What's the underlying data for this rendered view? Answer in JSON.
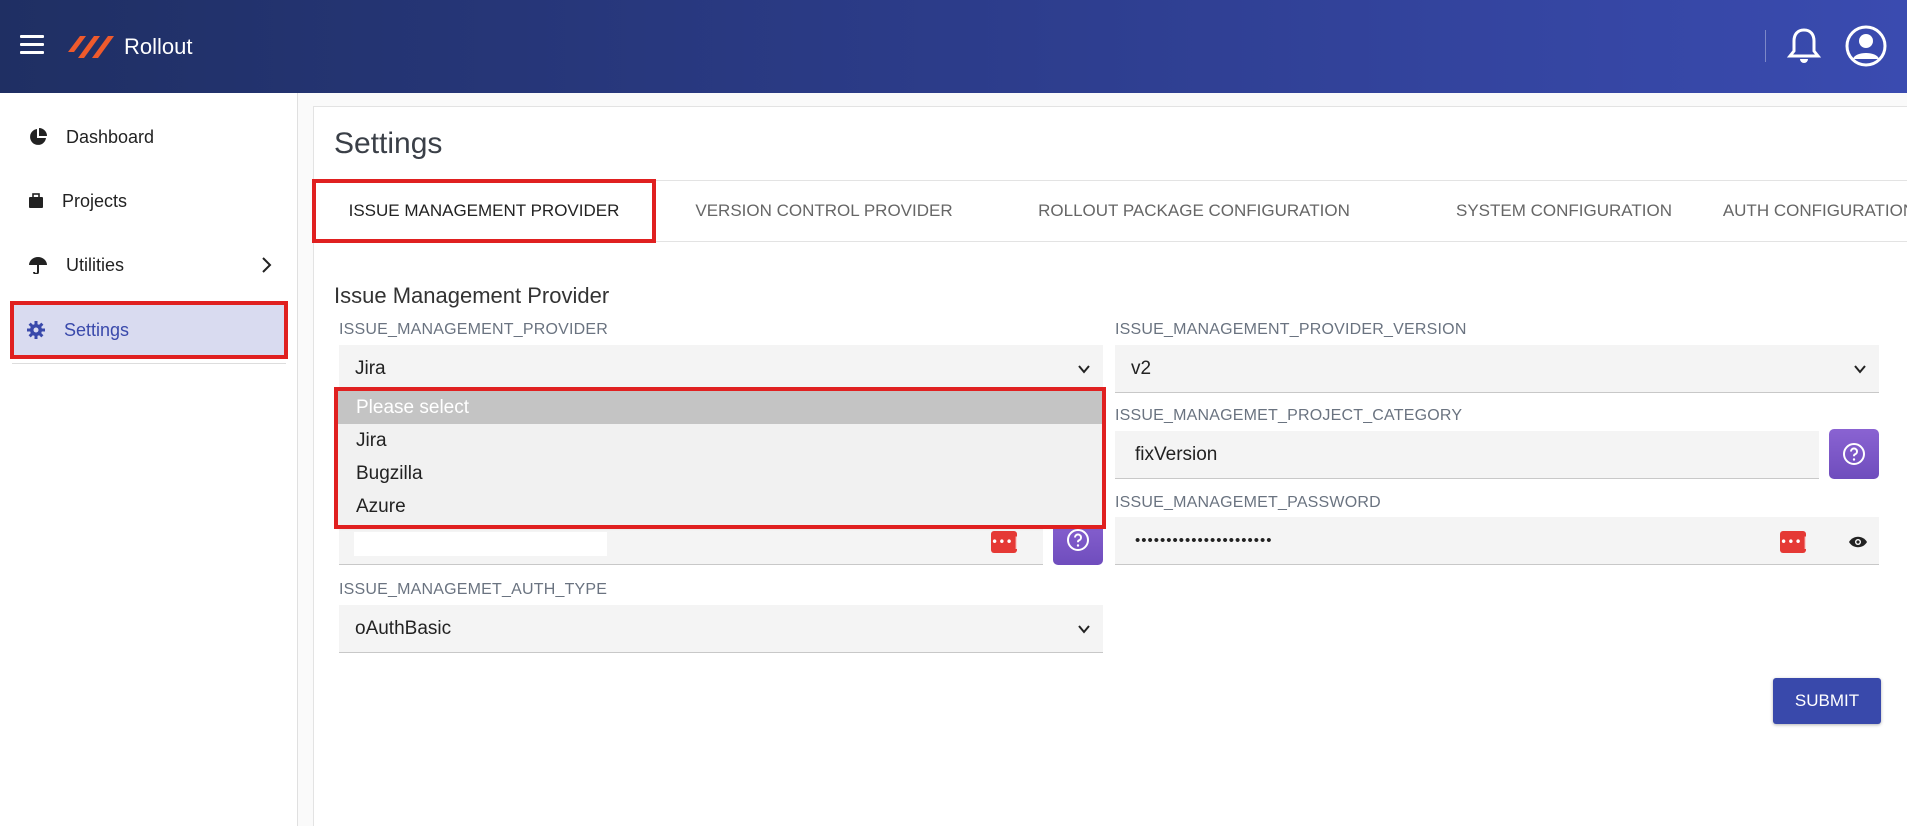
{
  "header": {
    "brand": "Rollout",
    "brand_color": "#ef5a2c"
  },
  "sidebar": {
    "items": [
      {
        "label": "Dashboard",
        "icon": "pie-chart-icon"
      },
      {
        "label": "Projects",
        "icon": "briefcase-icon"
      },
      {
        "label": "Utilities",
        "icon": "umbrella-icon",
        "has_children": true
      },
      {
        "label": "Settings",
        "icon": "gear-icon",
        "active": true
      }
    ]
  },
  "main": {
    "title": "Settings",
    "tabs": [
      {
        "label": "ISSUE MANAGEMENT PROVIDER",
        "active": true
      },
      {
        "label": "VERSION CONTROL PROVIDER"
      },
      {
        "label": "ROLLOUT PACKAGE CONFIGURATION"
      },
      {
        "label": "SYSTEM CONFIGURATION"
      },
      {
        "label": "AUTH CONFIGURATION"
      }
    ],
    "section_title": "Issue Management Provider",
    "fields": {
      "provider": {
        "label": "ISSUE_MANAGEMENT_PROVIDER",
        "value": "Jira"
      },
      "provider_version": {
        "label": "ISSUE_MANAGEMENT_PROVIDER_VERSION",
        "value": "v2"
      },
      "project_category": {
        "label": "ISSUE_MANAGEMET_PROJECT_CATEGORY",
        "value": "fixVersion"
      },
      "password": {
        "label": "ISSUE_MANAGEMET_PASSWORD",
        "value": "••••••••••••••••••••••"
      },
      "auth_type": {
        "label": "ISSUE_MANAGEMET_AUTH_TYPE",
        "value": "oAuthBasic"
      }
    },
    "provider_options": [
      "Please select",
      "Jira",
      "Bugzilla",
      "Azure"
    ],
    "submit_label": "SUBMIT"
  },
  "colors": {
    "accent": "#3949ab",
    "help_button": "#7b57c8",
    "highlight": "#e02020",
    "password_badge": "#e53935"
  }
}
